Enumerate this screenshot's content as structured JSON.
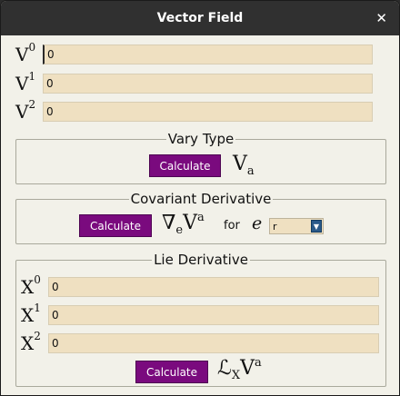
{
  "window": {
    "title": "Vector Field",
    "close_glyph": "✕"
  },
  "vector": [
    {
      "label": "V",
      "index": "0",
      "value": "0"
    },
    {
      "label": "V",
      "index": "1",
      "value": "0"
    },
    {
      "label": "V",
      "index": "2",
      "value": "0"
    }
  ],
  "vary_type": {
    "title": "Vary Type",
    "button": "Calculate",
    "result_base": "V",
    "result_sub": "a"
  },
  "covariant": {
    "title": "Covariant Derivative",
    "button": "Calculate",
    "nabla": "∇",
    "nabla_sub": "e",
    "base": "V",
    "base_sup": "a",
    "for_label": "for",
    "e_symbol": "e",
    "select_value": "r"
  },
  "lie": {
    "title": "Lie Derivative",
    "fields": [
      {
        "label": "X",
        "index": "0",
        "value": "0"
      },
      {
        "label": "X",
        "index": "1",
        "value": "0"
      },
      {
        "label": "X",
        "index": "2",
        "value": "0"
      }
    ],
    "button": "Calculate",
    "script_l": "ℒ",
    "script_sub": "X",
    "base": "V",
    "base_sup": "a"
  },
  "colors": {
    "button_bg": "#7a0a7e",
    "field_bg": "#efe0c1",
    "window_bg": "#f2f1e9",
    "titlebar_bg": "#303030"
  },
  "icons": {
    "close": "close-icon",
    "select_arrow": "chevron-down-icon"
  }
}
